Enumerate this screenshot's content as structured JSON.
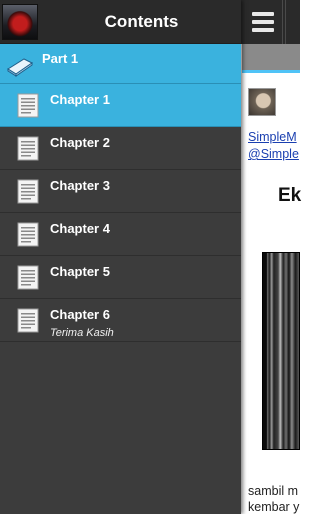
{
  "drawer": {
    "title": "Contents",
    "app_icon": "book-cover-icon",
    "part": {
      "label": "Part 1",
      "icon": "book-icon"
    },
    "chapters": [
      {
        "label": "Chapter 1",
        "subtitle": "",
        "active": true
      },
      {
        "label": "Chapter 2",
        "subtitle": "",
        "active": false
      },
      {
        "label": "Chapter 3",
        "subtitle": "",
        "active": false
      },
      {
        "label": "Chapter 4",
        "subtitle": "",
        "active": false
      },
      {
        "label": "Chapter 5",
        "subtitle": "",
        "active": false
      },
      {
        "label": "Chapter 6",
        "subtitle": "Terima Kasih",
        "active": false
      }
    ],
    "chapter_icon": "document-icon"
  },
  "reader": {
    "menu_icon": "hamburger-menu-icon",
    "author_link_1": "SimpleM",
    "author_link_2": "@Simple",
    "title": "Ek",
    "body_line_1": "sambil m",
    "body_line_2": "kembar y"
  },
  "colors": {
    "drawer_bg": "#3c3c3c",
    "header_bg": "#2a2a2a",
    "accent": "#3ab2de"
  }
}
